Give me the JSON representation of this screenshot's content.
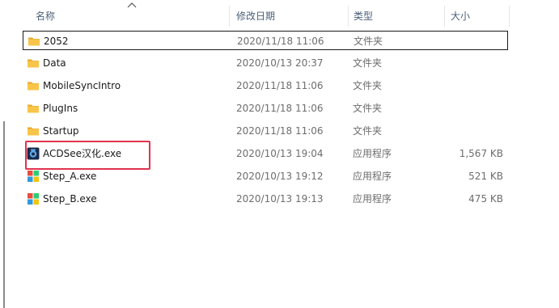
{
  "columns": {
    "name": "名称",
    "date": "修改日期",
    "type": "类型",
    "size": "大小"
  },
  "sort": {
    "column": "name",
    "direction": "ascending",
    "indicator_icon": "sort-up-arrow-icon"
  },
  "files": [
    {
      "name": "2052",
      "date": "2020/11/18 11:06",
      "type": "文件夹",
      "size": "",
      "icon": "folder-icon",
      "selected": true
    },
    {
      "name": "Data",
      "date": "2020/10/13 20:37",
      "type": "文件夹",
      "size": "",
      "icon": "folder-icon",
      "selected": false
    },
    {
      "name": "MobileSyncIntro",
      "date": "2020/11/18 11:06",
      "type": "文件夹",
      "size": "",
      "icon": "folder-icon",
      "selected": false
    },
    {
      "name": "PlugIns",
      "date": "2020/11/18 11:06",
      "type": "文件夹",
      "size": "",
      "icon": "folder-icon",
      "selected": false
    },
    {
      "name": "Startup",
      "date": "2020/11/18 11:06",
      "type": "文件夹",
      "size": "",
      "icon": "folder-icon",
      "selected": false
    },
    {
      "name": "ACDSee汉化.exe",
      "date": "2020/10/13 19:04",
      "type": "应用程序",
      "size": "1,567 KB",
      "icon": "acdsee-app-icon",
      "selected": false,
      "annotated": true
    },
    {
      "name": "Step_A.exe",
      "date": "2020/10/13 19:12",
      "type": "应用程序",
      "size": "521 KB",
      "icon": "windows-app-icon",
      "selected": false
    },
    {
      "name": "Step_B.exe",
      "date": "2020/10/13 19:13",
      "type": "应用程序",
      "size": "475 KB",
      "icon": "windows-app-icon",
      "selected": false
    }
  ],
  "colors": {
    "header_text": "#4c607a",
    "detail_text": "#6d6d6d",
    "folder_yellow": "#f8c54a",
    "annotation_red": "#e0334f"
  }
}
